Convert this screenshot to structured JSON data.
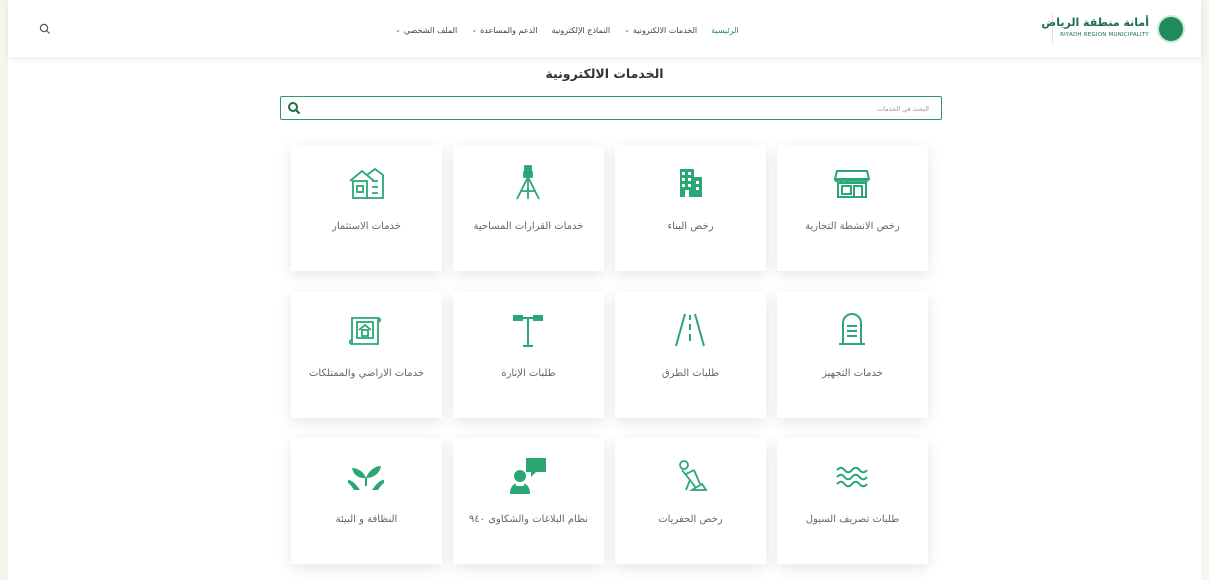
{
  "header": {
    "logo_ar": "أمانة منطقة الرياض",
    "logo_en": "RIYADH REGION MUNICIPALITY",
    "nav": [
      {
        "label": "الرئيسية",
        "caret": false,
        "active": true
      },
      {
        "label": "الخدمات الالكترونية",
        "caret": true,
        "active": false
      },
      {
        "label": "النماذج الإلكترونية",
        "caret": false,
        "active": false
      },
      {
        "label": "الدعم والمساعدة",
        "caret": true,
        "active": false
      },
      {
        "label": "الملف الشخصي",
        "caret": true,
        "active": false
      }
    ]
  },
  "page_title": "الخدمات الالكترونية",
  "search": {
    "placeholder": "البحث في الخدمات",
    "value": ""
  },
  "services": [
    {
      "label": "رخص الانشطة التجارية",
      "icon": "storefront-icon"
    },
    {
      "label": "رخص البناء",
      "icon": "building-icon"
    },
    {
      "label": "خدمات القرارات المساحية",
      "icon": "survey-tripod-icon"
    },
    {
      "label": "خدمات الاستثمار",
      "icon": "investment-buildings-icon"
    },
    {
      "label": "خدمات التجهيز",
      "icon": "tombstone-icon"
    },
    {
      "label": "طلبات الطرق",
      "icon": "road-icon"
    },
    {
      "label": "طلبات الإنارة",
      "icon": "street-light-icon"
    },
    {
      "label": "خدمات الاراضي والممتلكات",
      "icon": "land-plan-icon"
    },
    {
      "label": "طلبات تصريف السيول",
      "icon": "water-waves-icon"
    },
    {
      "label": "رخص الحفريات",
      "icon": "excavation-worker-icon"
    },
    {
      "label": "نظام البلاغات والشكاوى ٩٤٠",
      "icon": "report-chat-icon"
    },
    {
      "label": "النظافة و البيئة",
      "icon": "hands-leaves-icon"
    }
  ],
  "colors": {
    "accent": "#1f8a5b",
    "icon": "#2aa775"
  }
}
